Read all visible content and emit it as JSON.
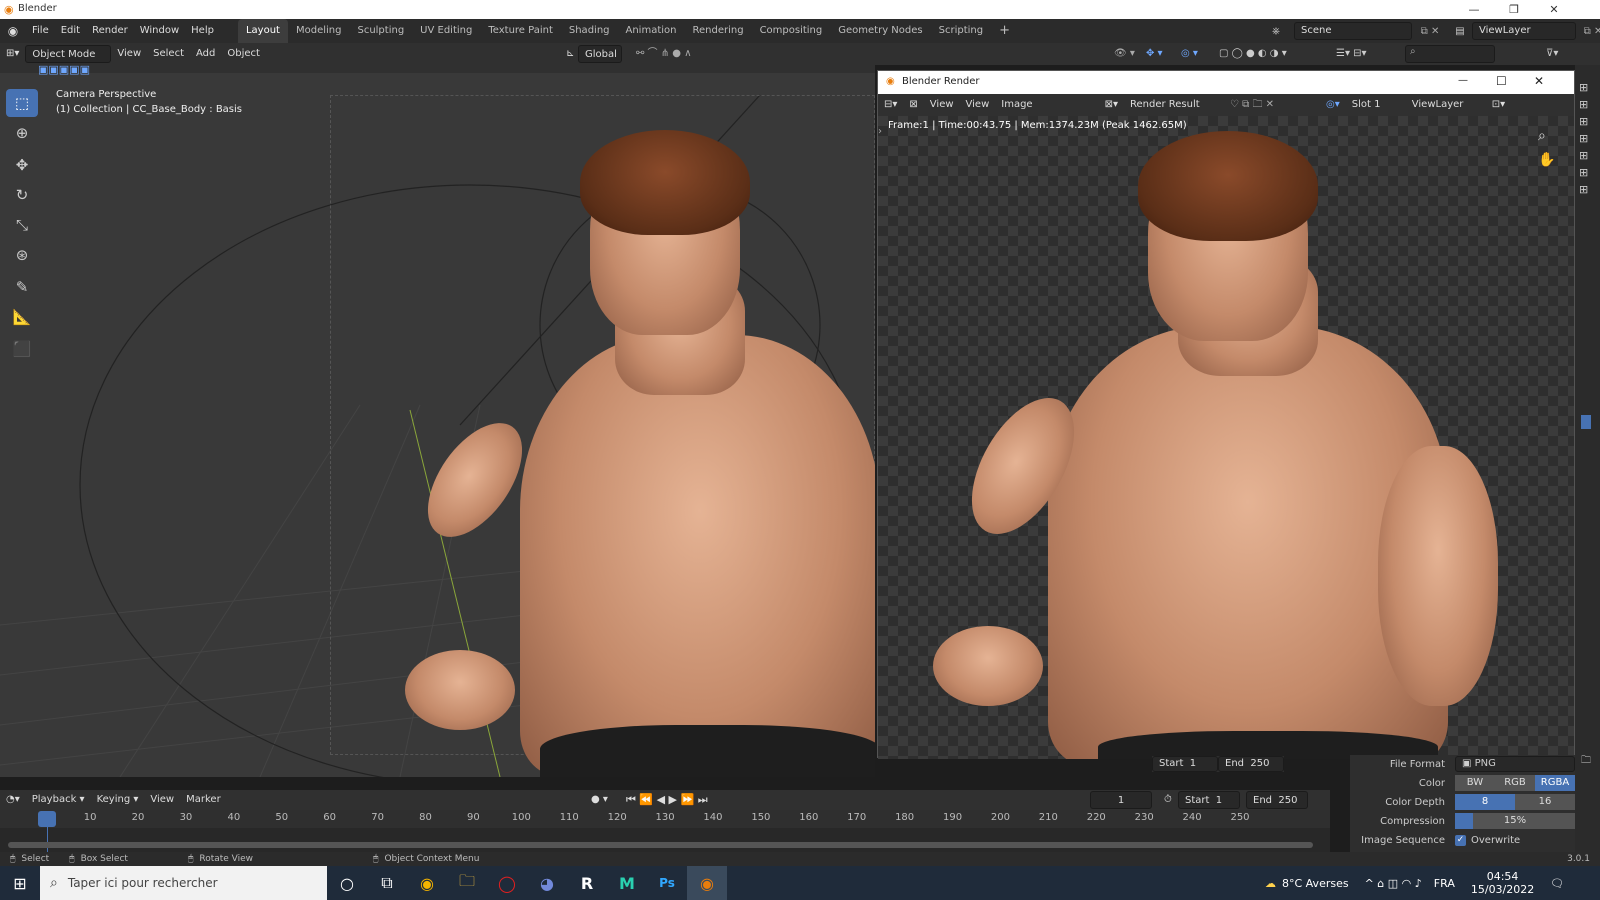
{
  "window": {
    "title": "Blender"
  },
  "menus": [
    "File",
    "Edit",
    "Render",
    "Window",
    "Help"
  ],
  "workspaces": [
    "Layout",
    "Modeling",
    "Sculpting",
    "UV Editing",
    "Texture Paint",
    "Shading",
    "Animation",
    "Rendering",
    "Compositing",
    "Geometry Nodes",
    "Scripting"
  ],
  "scene": {
    "name": "Scene",
    "view_layer": "ViewLayer"
  },
  "header": {
    "mode": "Object Mode",
    "view": "View",
    "select": "Select",
    "add": "Add",
    "object": "Object",
    "orientation": "Global"
  },
  "viewport": {
    "camera_label": "Camera Perspective",
    "collection_label": "(1) Collection | CC_Base_Body : Basis"
  },
  "render_window": {
    "title": "Blender Render",
    "view": "View",
    "view2": "View",
    "image": "Image",
    "result": "Render Result",
    "slot": "Slot 1",
    "view_layer": "ViewLayer",
    "stats": "Frame:1 | Time:00:43.75 | Mem:1374.23M (Peak 1462.65M)"
  },
  "output": {
    "start_label": "Start",
    "start": "1",
    "end_label": "End",
    "end": "250",
    "file_format_label": "File Format",
    "file_format": "PNG",
    "color_label": "Color",
    "color_options": [
      "BW",
      "RGB",
      "RGBA"
    ],
    "color_selected": "RGBA",
    "depth_label": "Color Depth",
    "depth_options": [
      "8",
      "16"
    ],
    "depth_selected": "8",
    "compression_label": "Compression",
    "compression": "15%",
    "compression_value": 0.15,
    "image_sequence_label": "Image Sequence",
    "overwrite_label": "Overwrite"
  },
  "timeline": {
    "playback": "Playback",
    "keying": "Keying",
    "view": "View",
    "marker": "Marker",
    "current_frame": "1",
    "start_label": "Start",
    "start": "1",
    "end_label": "End",
    "end": "250",
    "ticks": [
      "1",
      "10",
      "20",
      "30",
      "40",
      "50",
      "60",
      "70",
      "80",
      "90",
      "100",
      "110",
      "120",
      "130",
      "140",
      "150",
      "160",
      "170",
      "180",
      "190",
      "200",
      "210",
      "220",
      "230",
      "240",
      "250"
    ]
  },
  "statusbar": {
    "select": "Select",
    "box_select": "Box Select",
    "rotate": "Rotate View",
    "context": "Object Context Menu",
    "version": "3.0.1"
  },
  "taskbar": {
    "search_placeholder": "Taper ici pour rechercher",
    "weather": "8°C  Averses",
    "lang": "FRA",
    "time": "04:54",
    "date": "15/03/2022"
  }
}
